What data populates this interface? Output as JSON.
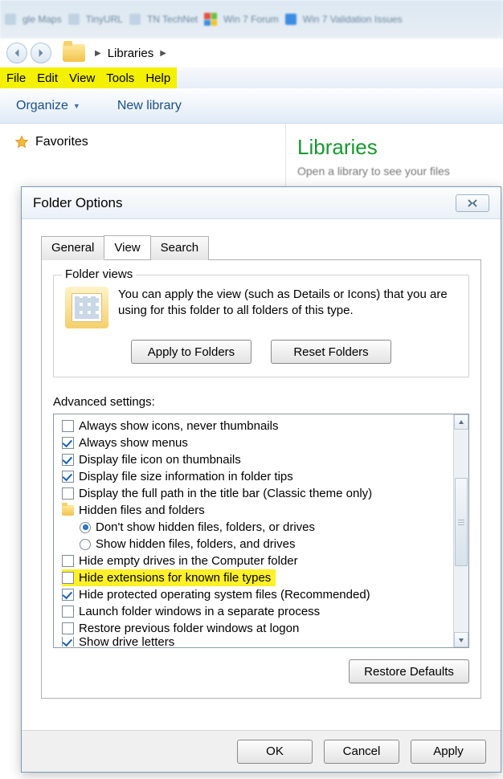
{
  "browser_tabs": [
    "gle Maps",
    "TinyURL",
    "TN TechNet",
    "Win 7 Forum",
    "Win 7 Validation Issues"
  ],
  "breadcrumb": {
    "root": "Libraries"
  },
  "menubar": [
    "File",
    "Edit",
    "View",
    "Tools",
    "Help"
  ],
  "toolbar": {
    "organize": "Organize",
    "newlib": "New library"
  },
  "sidebar": {
    "favorites": "Favorites"
  },
  "mainpane": {
    "title": "Libraries",
    "subtitle": "Open a library to see your files"
  },
  "dialog": {
    "title": "Folder Options",
    "tabs": [
      "General",
      "View",
      "Search"
    ],
    "active_tab": 1,
    "folder_views": {
      "group_title": "Folder views",
      "text": "You can apply the view (such as Details or Icons) that you are using for this folder to all folders of this type.",
      "apply_btn": "Apply to Folders",
      "reset_btn": "Reset Folders"
    },
    "advanced_label": "Advanced settings:",
    "settings": [
      {
        "type": "check",
        "checked": false,
        "label": "Always show icons, never thumbnails"
      },
      {
        "type": "check",
        "checked": true,
        "label": "Always show menus"
      },
      {
        "type": "check",
        "checked": true,
        "label": "Display file icon on thumbnails"
      },
      {
        "type": "check",
        "checked": true,
        "label": "Display file size information in folder tips"
      },
      {
        "type": "check",
        "checked": false,
        "label": "Display the full path in the title bar (Classic theme only)"
      },
      {
        "type": "folder",
        "label": "Hidden files and folders"
      },
      {
        "type": "radio",
        "checked": true,
        "indent": 1,
        "label": "Don't show hidden files, folders, or drives"
      },
      {
        "type": "radio",
        "checked": false,
        "indent": 1,
        "label": "Show hidden files, folders, and drives"
      },
      {
        "type": "check",
        "checked": false,
        "label": "Hide empty drives in the Computer folder"
      },
      {
        "type": "check",
        "checked": false,
        "highlight": true,
        "label": "Hide extensions for known file types"
      },
      {
        "type": "check",
        "checked": true,
        "label": "Hide protected operating system files (Recommended)"
      },
      {
        "type": "check",
        "checked": false,
        "label": "Launch folder windows in a separate process"
      },
      {
        "type": "check",
        "checked": false,
        "label": "Restore previous folder windows at logon"
      },
      {
        "type": "check",
        "checked": true,
        "cut": true,
        "label": "Show drive letters"
      }
    ],
    "restore_defaults": "Restore Defaults",
    "buttons": {
      "ok": "OK",
      "cancel": "Cancel",
      "apply": "Apply"
    }
  }
}
